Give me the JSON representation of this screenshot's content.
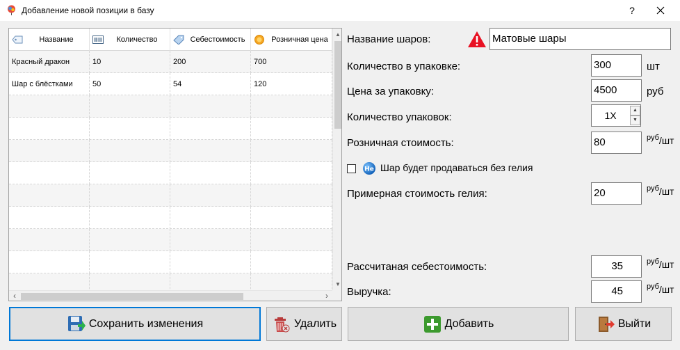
{
  "window": {
    "title": "Добавление новой позиции в базу",
    "help_label": "?",
    "icon": "balloon-icon"
  },
  "table": {
    "columns": [
      {
        "label": "Название",
        "icon": "tag-icon"
      },
      {
        "label": "Количество",
        "icon": "barcode-icon"
      },
      {
        "label": "Себестоимость",
        "icon": "price-tag-icon"
      },
      {
        "label": "Розничная цена",
        "icon": "coin-icon"
      }
    ],
    "rows": [
      [
        "Красный дракон",
        "10",
        "200",
        "700"
      ],
      [
        "Шар с блёстками",
        "50",
        "54",
        "120"
      ]
    ],
    "scroll_up": "▲",
    "scroll_down": "▼",
    "scroll_left": "‹",
    "scroll_right": "›"
  },
  "form": {
    "name_label": "Название шаров:",
    "name_value": "Матовые шары",
    "qty_label": "Количество в упаковке:",
    "qty_value": "300",
    "qty_unit": "шт",
    "price_label": "Цена за упаковку:",
    "price_value": "4500",
    "price_unit": "руб",
    "packs_label": "Количество упаковок:",
    "packs_value": "1X",
    "retail_label": "Розничная стоимость:",
    "retail_value": "80",
    "no_helium_label": "Шар будет продаваться без гелия",
    "no_helium_checked": false,
    "helium_label": "Примерная стоимость гелия:",
    "helium_value": "20",
    "cost_label": "Рассчитаная себестоимость:",
    "cost_value": "35",
    "revenue_label": "Выручка:",
    "revenue_value": "45",
    "unit_top": "руб",
    "unit_bottom": "шт"
  },
  "buttons": {
    "save": "Сохранить изменения",
    "delete": "Удалить",
    "add": "Добавить",
    "exit": "Выйти"
  },
  "colors": {
    "accent": "#0078d7",
    "warning": "#e81123",
    "add_green": "#3c9a2e"
  }
}
